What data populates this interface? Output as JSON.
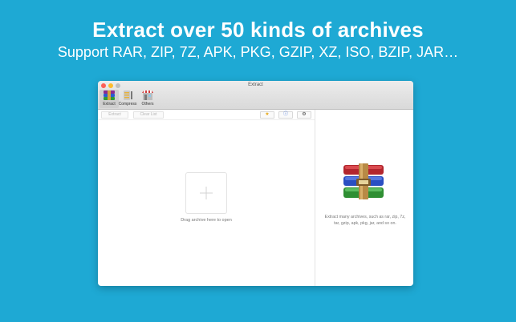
{
  "promo": {
    "headline": "Extract over 50 kinds of archives",
    "subline": "Support RAR, ZIP, 7Z, APK, PKG, GZIP, XZ, ISO, BZIP, JAR…"
  },
  "window": {
    "title": "Extract",
    "toolbar": {
      "extract_label": "Extract",
      "compress_label": "Compress",
      "others_label": "Others"
    },
    "actions": {
      "extract_button": "Extract",
      "clear_list_button": "Clear List",
      "favorites_icon": "star-icon",
      "info_icon": "info-icon",
      "settings_icon": "gear-icon"
    },
    "drop_area": {
      "hint": "Drag archive here to open"
    },
    "side_panel": {
      "description": "Extract many archives, such as rar, zip, 7z, tar, gzip, apk, pkg, jar, and so on."
    }
  },
  "colors": {
    "background": "#1ea9d4",
    "close": "#fc5f57",
    "minimize": "#fdbc2e"
  }
}
